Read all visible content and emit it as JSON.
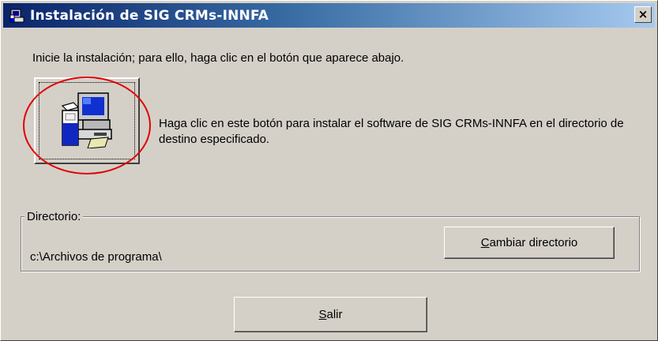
{
  "window": {
    "title": "Instalación de SIG CRMs-INNFA",
    "close_label": "×"
  },
  "main": {
    "instruction": "Inicie la instalación; para ello, haga clic en el botón que aparece abajo.",
    "install_description": "Haga clic en este botón para instalar el software de SIG CRMs-INNFA en el directorio de destino especificado.",
    "install_button_icon": "computer-setup-icon",
    "annotation": "red-ellipse-highlight"
  },
  "directory": {
    "legend": "Directorio:",
    "path": "c:\\Archivos de programa\\",
    "change_button_first": "C",
    "change_button_rest": "ambiar directorio"
  },
  "footer": {
    "exit_button_first": "S",
    "exit_button_rest": "alir"
  },
  "colors": {
    "face": "#d4d0c8",
    "title_start": "#0a246a",
    "title_end": "#a6caf0",
    "highlight_red": "#e00000"
  }
}
